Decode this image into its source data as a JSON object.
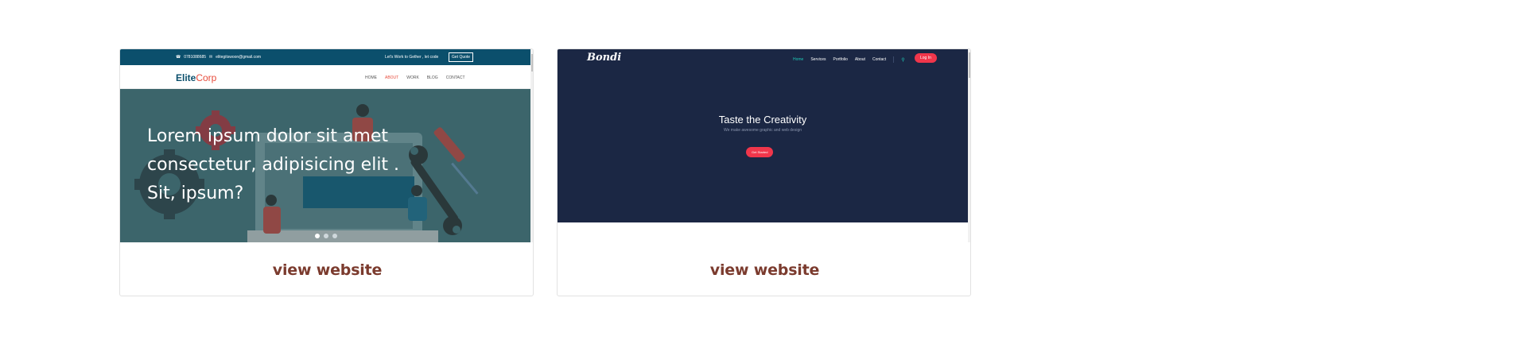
{
  "cards": [
    {
      "site": {
        "phone": "0781088685",
        "email": "elitegitswoon@gmail.com",
        "tagline": "Let's Work to Gether , let code",
        "quote_button": "Get Quote",
        "logo_elite": "Elite",
        "logo_corp": "Corp",
        "menu": [
          "HOME",
          "ABOUT",
          "WORK",
          "BLOG",
          "CONTACT"
        ],
        "active_menu": "ABOUT",
        "headline": "Lorem ipsum dolor sit amet consectetur, adipisicing elit . Sit, ipsum?",
        "slides": 3
      },
      "link_label": "view website"
    },
    {
      "site": {
        "logo": "Bondi",
        "menu": [
          "Home",
          "Services",
          "Portfolio",
          "About",
          "Contact"
        ],
        "active_menu": "Home",
        "login_button": "Log In",
        "hero_title": "Taste the Creativity",
        "hero_subtitle": "We make awesome graphic and web design",
        "cta_button": "Get Started"
      },
      "link_label": "view website"
    }
  ],
  "colors": {
    "link": "#7b3b2e",
    "elitecorp_primary": "#0b4f6c",
    "elitecorp_accent": "#e74c3c",
    "bondi_background": "#1b2744",
    "bondi_accent": "#f0364b",
    "bondi_teal": "#1fc8b5"
  }
}
